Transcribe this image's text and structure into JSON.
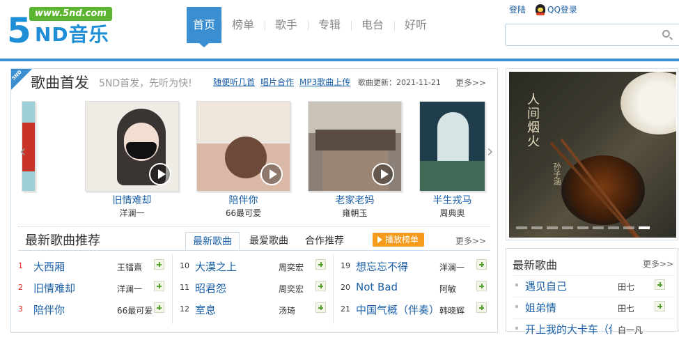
{
  "header": {
    "logo_url": "www.5nd.com",
    "logo_5": "5",
    "logo_text": "ND音乐",
    "nav": [
      "首页",
      "榜单",
      "歌手",
      "专辑",
      "电台",
      "好听"
    ],
    "login": "登陆",
    "qq_login": "QQ登录",
    "search_placeholder": ""
  },
  "colors": {
    "primary": "#3b8fd0",
    "link": "#1a5fa8",
    "play_button": "#f59a1a",
    "hot_rank": "#e0251b"
  },
  "new_release": {
    "corner_tag": "5ND",
    "title": "歌曲首发",
    "subtitle": "5ND首发，先听为快!",
    "links": [
      "随便听几首",
      "唱片合作",
      "MP3歌曲上传"
    ],
    "update": "歌曲更新：2021-11-21",
    "more": "更多>>",
    "albums": [
      {
        "title": "旧情难却",
        "artist": "洋澜一"
      },
      {
        "title": "陪伴你",
        "artist": "66最可爱"
      },
      {
        "title": "老家老妈",
        "artist": "雍朝玉"
      },
      {
        "title": "半生戎马",
        "artist": "周典奥"
      }
    ],
    "prev_arrow": "‹",
    "next_arrow": "›"
  },
  "recommend": {
    "title": "最新歌曲推荐",
    "tabs": [
      "最新歌曲",
      "最爱歌曲",
      "合作推荐"
    ],
    "play_button": "播放榜单",
    "more": "更多>>",
    "columns": [
      [
        {
          "num": "1",
          "name": "大西厢",
          "artist": "王镭熹"
        },
        {
          "num": "2",
          "name": "旧情难却",
          "artist": "洋澜一"
        },
        {
          "num": "3",
          "name": "陪伴你",
          "artist": "66最可爱"
        }
      ],
      [
        {
          "num": "10",
          "name": "大漠之上",
          "artist": "周奕宏"
        },
        {
          "num": "11",
          "name": "昭君怨",
          "artist": "周奕宏"
        },
        {
          "num": "12",
          "name": "室息",
          "artist": "汤琦"
        }
      ],
      [
        {
          "num": "19",
          "name": "想忘忘不得",
          "artist": "洋澜一"
        },
        {
          "num": "20",
          "name": "Not Bad",
          "artist": "阿敏"
        },
        {
          "num": "21",
          "name": "中国气概（伴奏）",
          "artist": "韩晓辉"
        }
      ]
    ]
  },
  "banner": {
    "title": "人间烟火",
    "artist": "孙子涵",
    "active_slide": 9,
    "slide_count": 9
  },
  "side_latest": {
    "title": "最新歌曲",
    "more": "更多>>",
    "items": [
      {
        "name": "遇见自己",
        "artist": "田七"
      },
      {
        "name": "姐弟情",
        "artist": "田七"
      },
      {
        "name": "开上我的大卡车（伴",
        "artist": "白一凡"
      }
    ]
  }
}
